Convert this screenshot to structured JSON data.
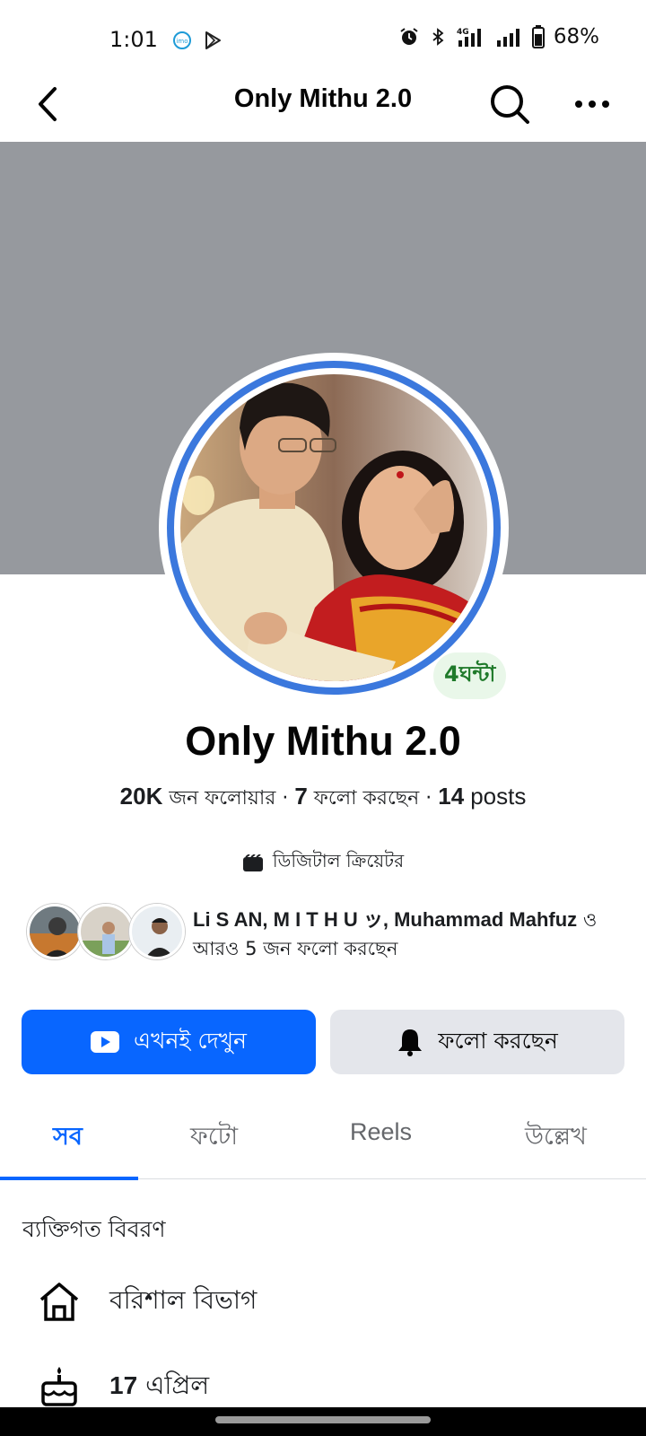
{
  "status_bar": {
    "time": "1:01",
    "icons": [
      "imo-icon",
      "play-store-icon"
    ],
    "right_icons": [
      "alarm-icon",
      "bluetooth-icon",
      "4g-signal-icon",
      "signal-icon",
      "battery-icon"
    ],
    "network": "4G",
    "battery": "68%"
  },
  "header": {
    "title": "Only Mithu 2.0"
  },
  "profile": {
    "name": "Only Mithu 2.0",
    "story_badge": "4ঘন্টা",
    "followers_count": "20K",
    "followers_label": "জন ফলোয়ার",
    "following_count": "7",
    "following_label": "ফলো করছেন",
    "posts_count": "14",
    "posts_label": "posts",
    "category": "ডিজিটাল ক্রিয়েটর"
  },
  "mutuals": {
    "names": "Li S AN, M    I    T    H    U    ッ, Muhammad Mahfuz",
    "suffix": "ও আরও 5 জন ফলো করছেন"
  },
  "actions": {
    "watch_label": "এখনই দেখুন",
    "following_label": "ফলো করছেন"
  },
  "tabs": [
    {
      "label": "সব",
      "active": true
    },
    {
      "label": "ফটো",
      "active": false
    },
    {
      "label": "Reels",
      "active": false
    },
    {
      "label": "উল্লেখ",
      "active": false
    }
  ],
  "details": {
    "section_title": "ব্যক্তিগত বিবরণ",
    "location": "বরিশাল বিভাগ",
    "birthday_day": "17",
    "birthday_month": "এপ্রিল"
  },
  "colors": {
    "accent": "#0866ff",
    "ring": "#3b78dd",
    "cover": "#96999e",
    "story_badge_text": "#1f7a2a"
  }
}
